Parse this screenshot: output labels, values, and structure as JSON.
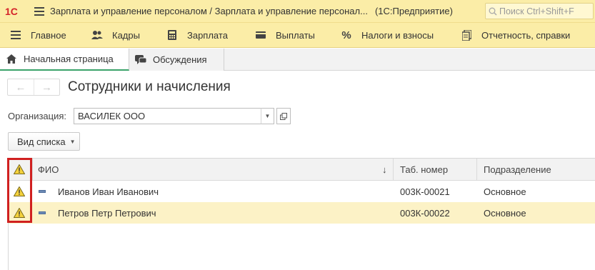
{
  "titlebar": {
    "logo_text": "1С",
    "title": "Зарплата и управление персоналом / Зарплата и управление персонал...",
    "suffix": "(1С:Предприятие)",
    "search_placeholder": "Поиск Ctrl+Shift+F"
  },
  "menu": {
    "items": [
      {
        "label": "Главное",
        "icon": "hamburger-icon"
      },
      {
        "label": "Кадры",
        "icon": "people-icon"
      },
      {
        "label": "Зарплата",
        "icon": "calculator-icon"
      },
      {
        "label": "Выплаты",
        "icon": "wallet-icon"
      },
      {
        "label": "Налоги и взносы",
        "icon": "percent-icon"
      },
      {
        "label": "Отчетность, справки",
        "icon": "documents-icon"
      }
    ]
  },
  "tabs": [
    {
      "label": "Начальная страница",
      "icon": "home-icon",
      "active": true
    },
    {
      "label": "Обсуждения",
      "icon": "chat-icon",
      "active": false
    }
  ],
  "page": {
    "title": "Сотрудники и начисления",
    "org_label": "Организация:",
    "org_value": "ВАСИЛЕК ООО",
    "view_button": "Вид списка"
  },
  "table": {
    "columns": [
      "ФИО",
      "Таб. номер",
      "Подразделение"
    ],
    "sort_indicator": "↓",
    "rows": [
      {
        "name": "Иванов Иван Иванович",
        "tab_number": "003К-00021",
        "department": "Основное"
      },
      {
        "name": "Петров Петр Петрович",
        "tab_number": "003К-00022",
        "department": "Основное"
      }
    ]
  },
  "colors": {
    "header_bg": "#fbeda7",
    "selected_row": "#fcf2c6",
    "highlight": "#d02020",
    "active_tab_underline": "#3aa36a"
  }
}
